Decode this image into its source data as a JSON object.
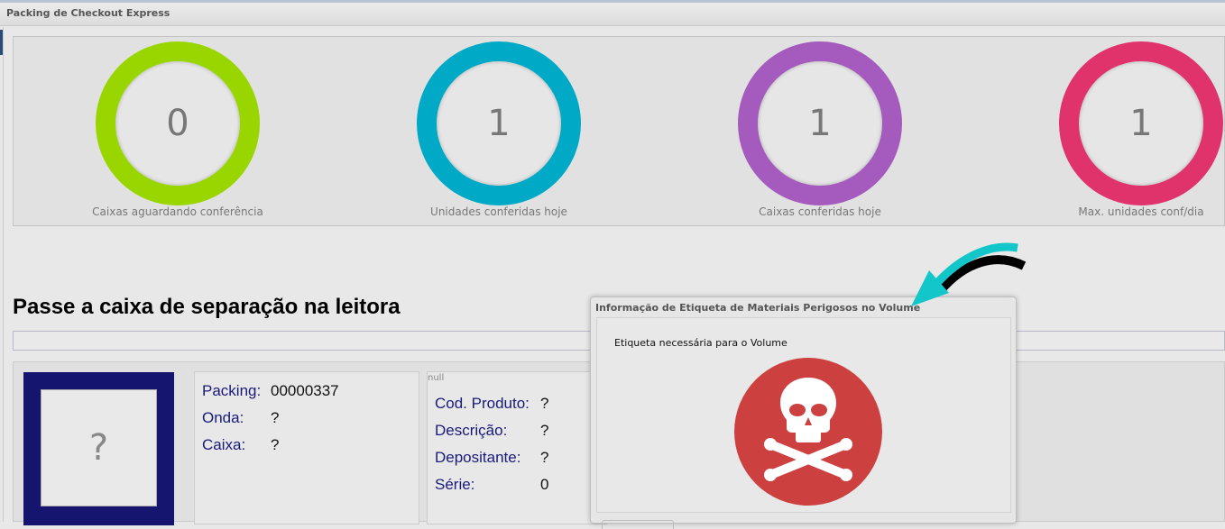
{
  "window": {
    "title": "Packing de Checkout Express"
  },
  "stats": [
    {
      "value": "0",
      "label": "Caixas aguardando conferência",
      "color": "#99d600"
    },
    {
      "value": "1",
      "label": "Unidades conferidas hoje",
      "color": "#00a9c6"
    },
    {
      "value": "1",
      "label": "Caixas conferidas hoje",
      "color": "#a55bbd"
    },
    {
      "value": "1",
      "label": "Max. unidades conf/dia",
      "color": "#e0336b"
    }
  ],
  "instruction": "Passe a caixa de separação na leitora",
  "image_placeholder": "?",
  "packing_info": {
    "packing_label": "Packing:",
    "packing_value": "00000337",
    "onda_label": "Onda:",
    "onda_value": "?",
    "caixa_label": "Caixa:",
    "caixa_value": "?"
  },
  "product_info": {
    "null_text": "null",
    "cod_label": "Cod. Produto:",
    "cod_value": "?",
    "desc_label": "Descrição:",
    "desc_value": "?",
    "dep_label": "Depositante:",
    "dep_value": "?",
    "serie_label": "Série:",
    "serie_value": "0"
  },
  "dialog": {
    "title": "Informação de Etiqueta de Materiais Perigosos no Volume",
    "message": "Etiqueta necessária para o Volume",
    "icon": "skull-crossbones-icon",
    "icon_color": "#cc4040"
  }
}
